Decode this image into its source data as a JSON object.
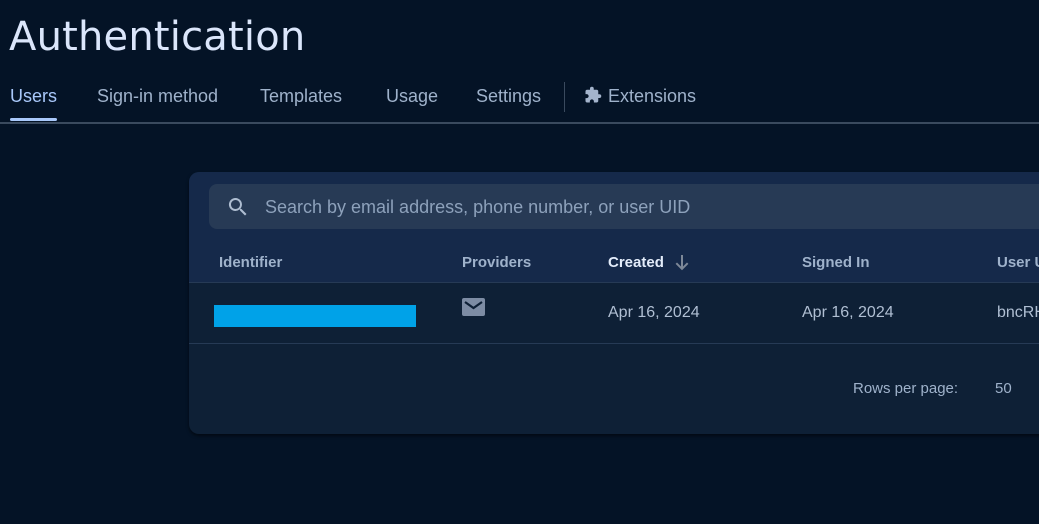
{
  "page": {
    "title": "Authentication"
  },
  "tabs": [
    {
      "label": "Users",
      "active": true
    },
    {
      "label": "Sign-in method"
    },
    {
      "label": "Templates"
    },
    {
      "label": "Usage"
    },
    {
      "label": "Settings"
    },
    {
      "label": "Extensions",
      "icon": "puzzle-icon"
    }
  ],
  "search": {
    "placeholder": "Search by email address, phone number, or user UID",
    "value": ""
  },
  "table": {
    "columns": [
      "Identifier",
      "Providers",
      "Created",
      "Signed In",
      "User U"
    ],
    "sorted_column": "Created",
    "sort_direction": "descending",
    "rows": [
      {
        "identifier": "",
        "identifier_redacted": true,
        "provider": "email-icon",
        "created": "Apr 16, 2024",
        "signed_in": "Apr 16, 2024",
        "uid": "bncRH"
      }
    ]
  },
  "pagination": {
    "rows_per_page_label": "Rows per page:",
    "rows_per_page": "50"
  },
  "colors": {
    "accent": "#a9c8fa",
    "redaction": "#00a2e8",
    "background": "#041326",
    "card": "#0e2036"
  }
}
